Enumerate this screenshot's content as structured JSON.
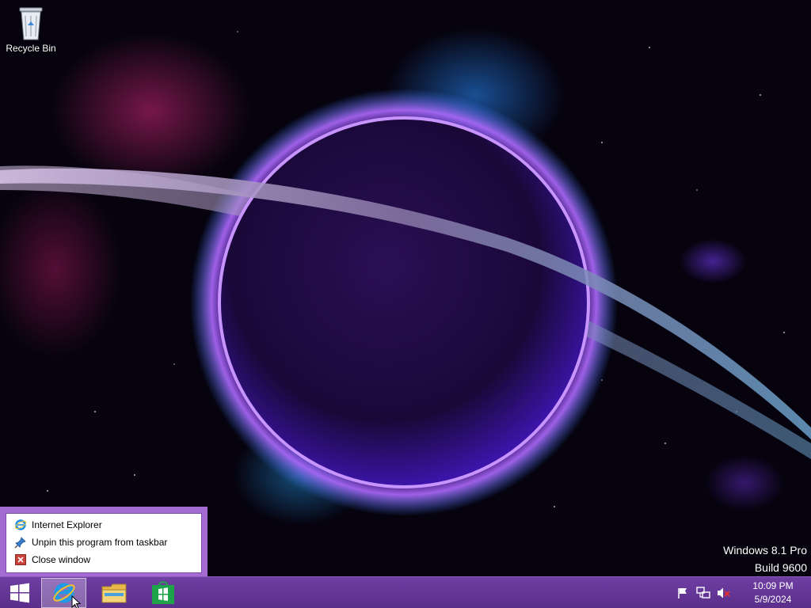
{
  "desktop": {
    "icons": [
      {
        "label": "Recycle Bin",
        "icon": "recycle-bin-icon"
      }
    ]
  },
  "watermark": {
    "line1": "Windows 8.1 Pro",
    "line2": "Build 9600"
  },
  "jumplist": {
    "items": [
      {
        "label": "Internet Explorer",
        "icon": "internet-explorer-icon"
      },
      {
        "label": "Unpin this program from taskbar",
        "icon": "unpin-icon"
      },
      {
        "label": "Close window",
        "icon": "close-icon"
      }
    ]
  },
  "taskbar": {
    "buttons": [
      {
        "name": "Start",
        "icon": "windows-logo-icon"
      },
      {
        "name": "Internet Explorer",
        "icon": "internet-explorer-icon",
        "active": true
      },
      {
        "name": "File Explorer",
        "icon": "folder-icon"
      },
      {
        "name": "Store",
        "icon": "store-icon"
      }
    ],
    "tray": {
      "icons": [
        "action-center-flag-icon",
        "network-icon",
        "volume-muted-icon"
      ],
      "time": "10:09 PM",
      "date": "5/9/2024"
    }
  },
  "colors": {
    "taskbar": "#6a3a9e",
    "menu_border": "#a46cd2",
    "planet_glow": "#9b4dff"
  }
}
